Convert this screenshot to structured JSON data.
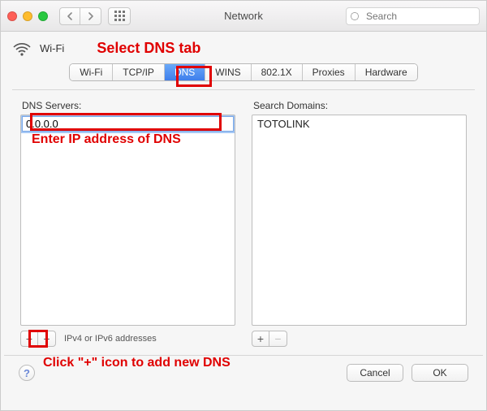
{
  "titlebar": {
    "title": "Network",
    "search_placeholder": "Search"
  },
  "header": {
    "wifi_label": "Wi-Fi"
  },
  "tabs": {
    "items": [
      "Wi-Fi",
      "TCP/IP",
      "DNS",
      "WINS",
      "802.1X",
      "Proxies",
      "Hardware"
    ],
    "active_index": 2
  },
  "dns": {
    "label": "DNS Servers:",
    "input_value": "0.0.0.0",
    "hint": "IPv4 or IPv6 addresses"
  },
  "search_domains": {
    "label": "Search Domains:",
    "items": [
      "TOTOLINK"
    ]
  },
  "footer": {
    "cancel": "Cancel",
    "ok": "OK"
  },
  "annotations": {
    "select_tab": "Select DNS tab",
    "enter_ip": "Enter IP address of DNS",
    "click_plus": "Click \"+\" icon to add new DNS"
  }
}
